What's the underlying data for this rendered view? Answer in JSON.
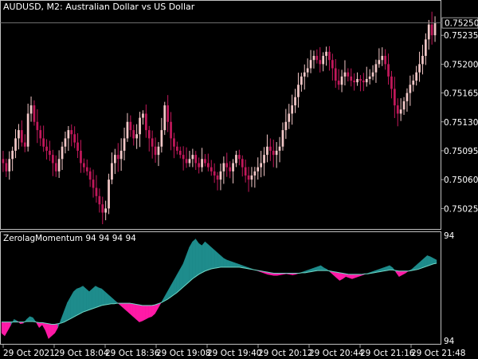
{
  "symbol_bar": {
    "symbol": "AUDUSD, M2:",
    "description": "Australian Dollar vs US Dollar"
  },
  "indicator_bar": {
    "name": "ZerolagMomentum 94 94 94 94"
  },
  "price_label": "0.75250",
  "indicator_scale_labels": [
    "94",
    "94"
  ],
  "colors": {
    "background": "#000000",
    "frame": "#c0c0c0",
    "candle_bull": "#f2c7c7",
    "candle_bear": "#c2185b",
    "candle_neutral": "#2e7d32",
    "momentum_positive": "#1e8c8c",
    "momentum_negative": "#ff1aa6",
    "signal_line": "#6fd6c4",
    "price_line": "#808080"
  },
  "chart_data": [
    {
      "type": "candlestick",
      "title": "AUDUSD, M2: Australian Dollar vs US Dollar",
      "y_ticks": [
        "0.75235",
        "0.75200",
        "0.75165",
        "0.75130",
        "0.75095",
        "0.75060",
        "0.75025"
      ],
      "ylim": [
        0.75005,
        0.7527
      ],
      "current_price": 0.7525,
      "x_ticks": [
        "29 Oct 2021",
        "29 Oct 18:04",
        "29 Oct 18:36",
        "29 Oct 19:08",
        "29 Oct 19:40",
        "29 Oct 20:12",
        "29 Oct 20:44",
        "29 Oct 21:16",
        "29 Oct 21:48"
      ],
      "close": [
        0.7508,
        0.7507,
        0.75085,
        0.75095,
        0.7511,
        0.7512,
        0.75105,
        0.751,
        0.7514,
        0.7515,
        0.7513,
        0.7512,
        0.7511,
        0.751,
        0.75095,
        0.7509,
        0.7508,
        0.7507,
        0.75085,
        0.751,
        0.7511,
        0.7512,
        0.75115,
        0.75105,
        0.75095,
        0.7508,
        0.75075,
        0.7507,
        0.7506,
        0.7505,
        0.7504,
        0.7503,
        0.7502,
        0.75025,
        0.7506,
        0.7508,
        0.7509,
        0.75085,
        0.75095,
        0.7511,
        0.7513,
        0.7512,
        0.7511,
        0.75115,
        0.75135,
        0.7514,
        0.7512,
        0.7511,
        0.751,
        0.7509,
        0.751,
        0.7512,
        0.7515,
        0.7513,
        0.7511,
        0.751,
        0.75095,
        0.7509,
        0.75085,
        0.7508,
        0.75085,
        0.7509,
        0.7508,
        0.75075,
        0.75085,
        0.7508,
        0.75075,
        0.7507,
        0.75065,
        0.7506,
        0.7507,
        0.7508,
        0.75075,
        0.7507,
        0.7508,
        0.7509,
        0.75085,
        0.75075,
        0.75065,
        0.7506,
        0.75065,
        0.7507,
        0.75075,
        0.7508,
        0.7509,
        0.751,
        0.75095,
        0.7509,
        0.75095,
        0.751,
        0.7512,
        0.7513,
        0.7514,
        0.7515,
        0.7516,
        0.75175,
        0.75185,
        0.7519,
        0.75195,
        0.75205,
        0.7521,
        0.75205,
        0.752,
        0.7521,
        0.75215,
        0.75205,
        0.75195,
        0.7518,
        0.75175,
        0.75185,
        0.7519,
        0.75185,
        0.7518,
        0.75178,
        0.75182,
        0.7518,
        0.75178,
        0.75182,
        0.75185,
        0.7519,
        0.752,
        0.75205,
        0.7521,
        0.752,
        0.75185,
        0.7517,
        0.7515,
        0.7514,
        0.75145,
        0.75155,
        0.75165,
        0.75175,
        0.7518,
        0.7519,
        0.752,
        0.7521,
        0.7523,
        0.75248,
        0.75235,
        0.7525
      ]
    },
    {
      "type": "area",
      "title": "ZerolagMomentum 94 94 94 94",
      "series": [
        {
          "values": [
            -0.2,
            -0.25,
            -0.15,
            -0.05,
            0.05,
            0.02,
            -0.03,
            -0.02,
            0.05,
            0.1,
            0.08,
            0.0,
            -0.1,
            -0.05,
            -0.15,
            -0.3,
            -0.25,
            -0.2,
            -0.1,
            0.05,
            0.2,
            0.35,
            0.45,
            0.55,
            0.6,
            0.62,
            0.65,
            0.6,
            0.55,
            0.6,
            0.65,
            0.62,
            0.6,
            0.55,
            0.5,
            0.45,
            0.4,
            0.35,
            0.3,
            0.25,
            0.2,
            0.15,
            0.1,
            0.05,
            0.0,
            0.02,
            0.05,
            0.08,
            0.1,
            0.15,
            0.25,
            0.35,
            0.45,
            0.55,
            0.65,
            0.75,
            0.85,
            0.95,
            1.05,
            1.2,
            1.35,
            1.45,
            1.5,
            1.42,
            1.38,
            1.45,
            1.4,
            1.35,
            1.3,
            1.25,
            1.2,
            1.15,
            1.12,
            1.1,
            1.08,
            1.06,
            1.04,
            1.02,
            1.0,
            0.98,
            0.96,
            0.94,
            0.92,
            0.9,
            0.88,
            0.86,
            0.85,
            0.84,
            0.84,
            0.85,
            0.86,
            0.87,
            0.86,
            0.85,
            0.86,
            0.88,
            0.9,
            0.92,
            0.94,
            0.96,
            0.98,
            1.0,
            1.02,
            0.98,
            0.95,
            0.9,
            0.85,
            0.8,
            0.75,
            0.78,
            0.82,
            0.8,
            0.78,
            0.8,
            0.82,
            0.84,
            0.86,
            0.88,
            0.9,
            0.92,
            0.94,
            0.96,
            0.98,
            1.0,
            1.02,
            0.98,
            0.9,
            0.82,
            0.85,
            0.88,
            0.92,
            0.95,
            1.0,
            1.05,
            1.1,
            1.15,
            1.2,
            1.18,
            1.15,
            1.12
          ]
        },
        {
          "values": [
            0.0,
            0.0,
            0.0,
            0.0,
            0.0,
            0.0,
            0.0,
            0.0,
            0.01,
            0.01,
            0.01,
            0.0,
            -0.01,
            -0.01,
            -0.02,
            -0.03,
            -0.04,
            -0.04,
            -0.03,
            -0.02,
            0.0,
            0.03,
            0.06,
            0.09,
            0.12,
            0.15,
            0.18,
            0.2,
            0.22,
            0.24,
            0.26,
            0.28,
            0.3,
            0.31,
            0.32,
            0.33,
            0.33,
            0.34,
            0.34,
            0.34,
            0.34,
            0.34,
            0.33,
            0.32,
            0.31,
            0.3,
            0.3,
            0.3,
            0.3,
            0.31,
            0.33,
            0.35,
            0.38,
            0.41,
            0.45,
            0.49,
            0.53,
            0.58,
            0.63,
            0.68,
            0.73,
            0.78,
            0.82,
            0.86,
            0.89,
            0.92,
            0.94,
            0.96,
            0.97,
            0.98,
            0.99,
            0.99,
            0.99,
            0.99,
            0.99,
            0.99,
            0.99,
            0.98,
            0.97,
            0.96,
            0.95,
            0.94,
            0.93,
            0.92,
            0.91,
            0.9,
            0.89,
            0.88,
            0.88,
            0.88,
            0.88,
            0.88,
            0.88,
            0.88,
            0.88,
            0.88,
            0.89,
            0.89,
            0.9,
            0.91,
            0.92,
            0.93,
            0.93,
            0.93,
            0.93,
            0.92,
            0.91,
            0.9,
            0.89,
            0.88,
            0.87,
            0.86,
            0.86,
            0.86,
            0.86,
            0.86,
            0.87,
            0.87,
            0.88,
            0.89,
            0.9,
            0.91,
            0.92,
            0.93,
            0.94,
            0.94,
            0.93,
            0.92,
            0.92,
            0.92,
            0.92,
            0.93,
            0.94,
            0.95,
            0.97,
            0.99,
            1.01,
            1.03,
            1.05,
            1.06
          ]
        }
      ]
    }
  ]
}
